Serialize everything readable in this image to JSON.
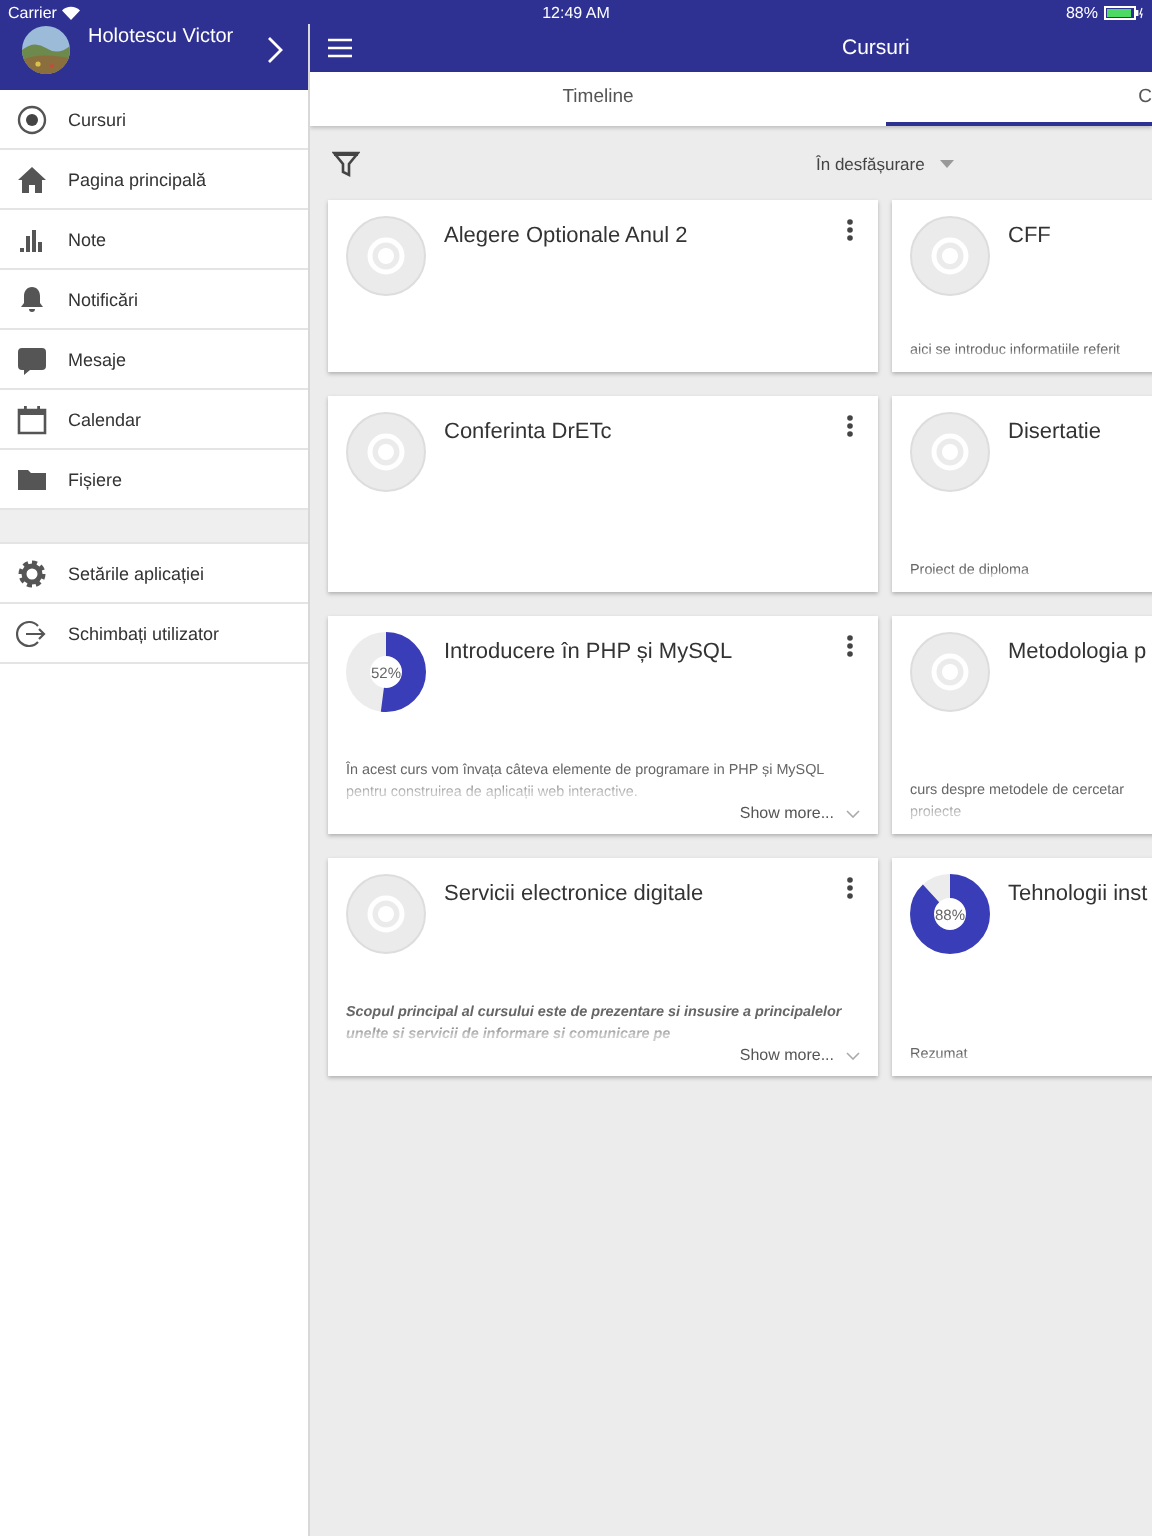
{
  "status_bar": {
    "carrier": "Carrier",
    "time": "12:49 AM",
    "battery": "88%"
  },
  "user": {
    "name": "Holotescu Victor"
  },
  "sidebar": {
    "items": [
      {
        "label": "Cursuri",
        "kind": "course"
      },
      {
        "label": "Pagina principală",
        "kind": "home"
      },
      {
        "label": "Note",
        "kind": "chart"
      },
      {
        "label": "Notificări",
        "kind": "bell"
      },
      {
        "label": "Mesaje",
        "kind": "message"
      },
      {
        "label": "Calendar",
        "kind": "calendar"
      },
      {
        "label": "Fișiere",
        "kind": "folder"
      }
    ],
    "settings_items": [
      {
        "label": "Setările aplicației",
        "kind": "gear"
      },
      {
        "label": "Schimbați utilizator",
        "kind": "logout"
      }
    ]
  },
  "header": {
    "title": "Cursuri"
  },
  "tabs": [
    {
      "label": "Timeline",
      "selected": false
    },
    {
      "label": "C",
      "selected": true
    }
  ],
  "filter": {
    "value": "În desfășurare"
  },
  "courses": [
    {
      "title": "Alegere Optionale Anul 2",
      "kind": "blank",
      "menu": true
    },
    {
      "title": "CFF",
      "kind": "blank",
      "menu": false,
      "description": "aici se introduc informatiile referit"
    },
    {
      "title": "Conferinta DrETc",
      "kind": "blank",
      "menu": true
    },
    {
      "title": "Disertatie",
      "kind": "blank",
      "menu": false,
      "description": "Proiect de diploma"
    },
    {
      "title": "Introducere în PHP și MySQL",
      "kind": "progress",
      "progress_label": "52%",
      "menu": true,
      "description": "În acest curs vom învața câteva elemente de programare in PHP și MySQL pentru construirea de aplicații web interactive.",
      "show_more": "Show more..."
    },
    {
      "title": "Metodologia p",
      "kind": "blank",
      "menu": false,
      "description": [
        "curs despre metodele de cercetar",
        "proiecte"
      ]
    },
    {
      "title": "Servicii electronice digitale",
      "kind": "blank",
      "menu": true,
      "emphasis": true,
      "description": "Scopul principal al cursului este de prezentare si insusire a principalelor unelte si servicii de informare si comunicare pe",
      "show_more": "Show more..."
    },
    {
      "title": "Tehnologii inst",
      "kind": "progress",
      "progress_label": "88%",
      "menu": false,
      "description": "Rezumat"
    }
  ]
}
